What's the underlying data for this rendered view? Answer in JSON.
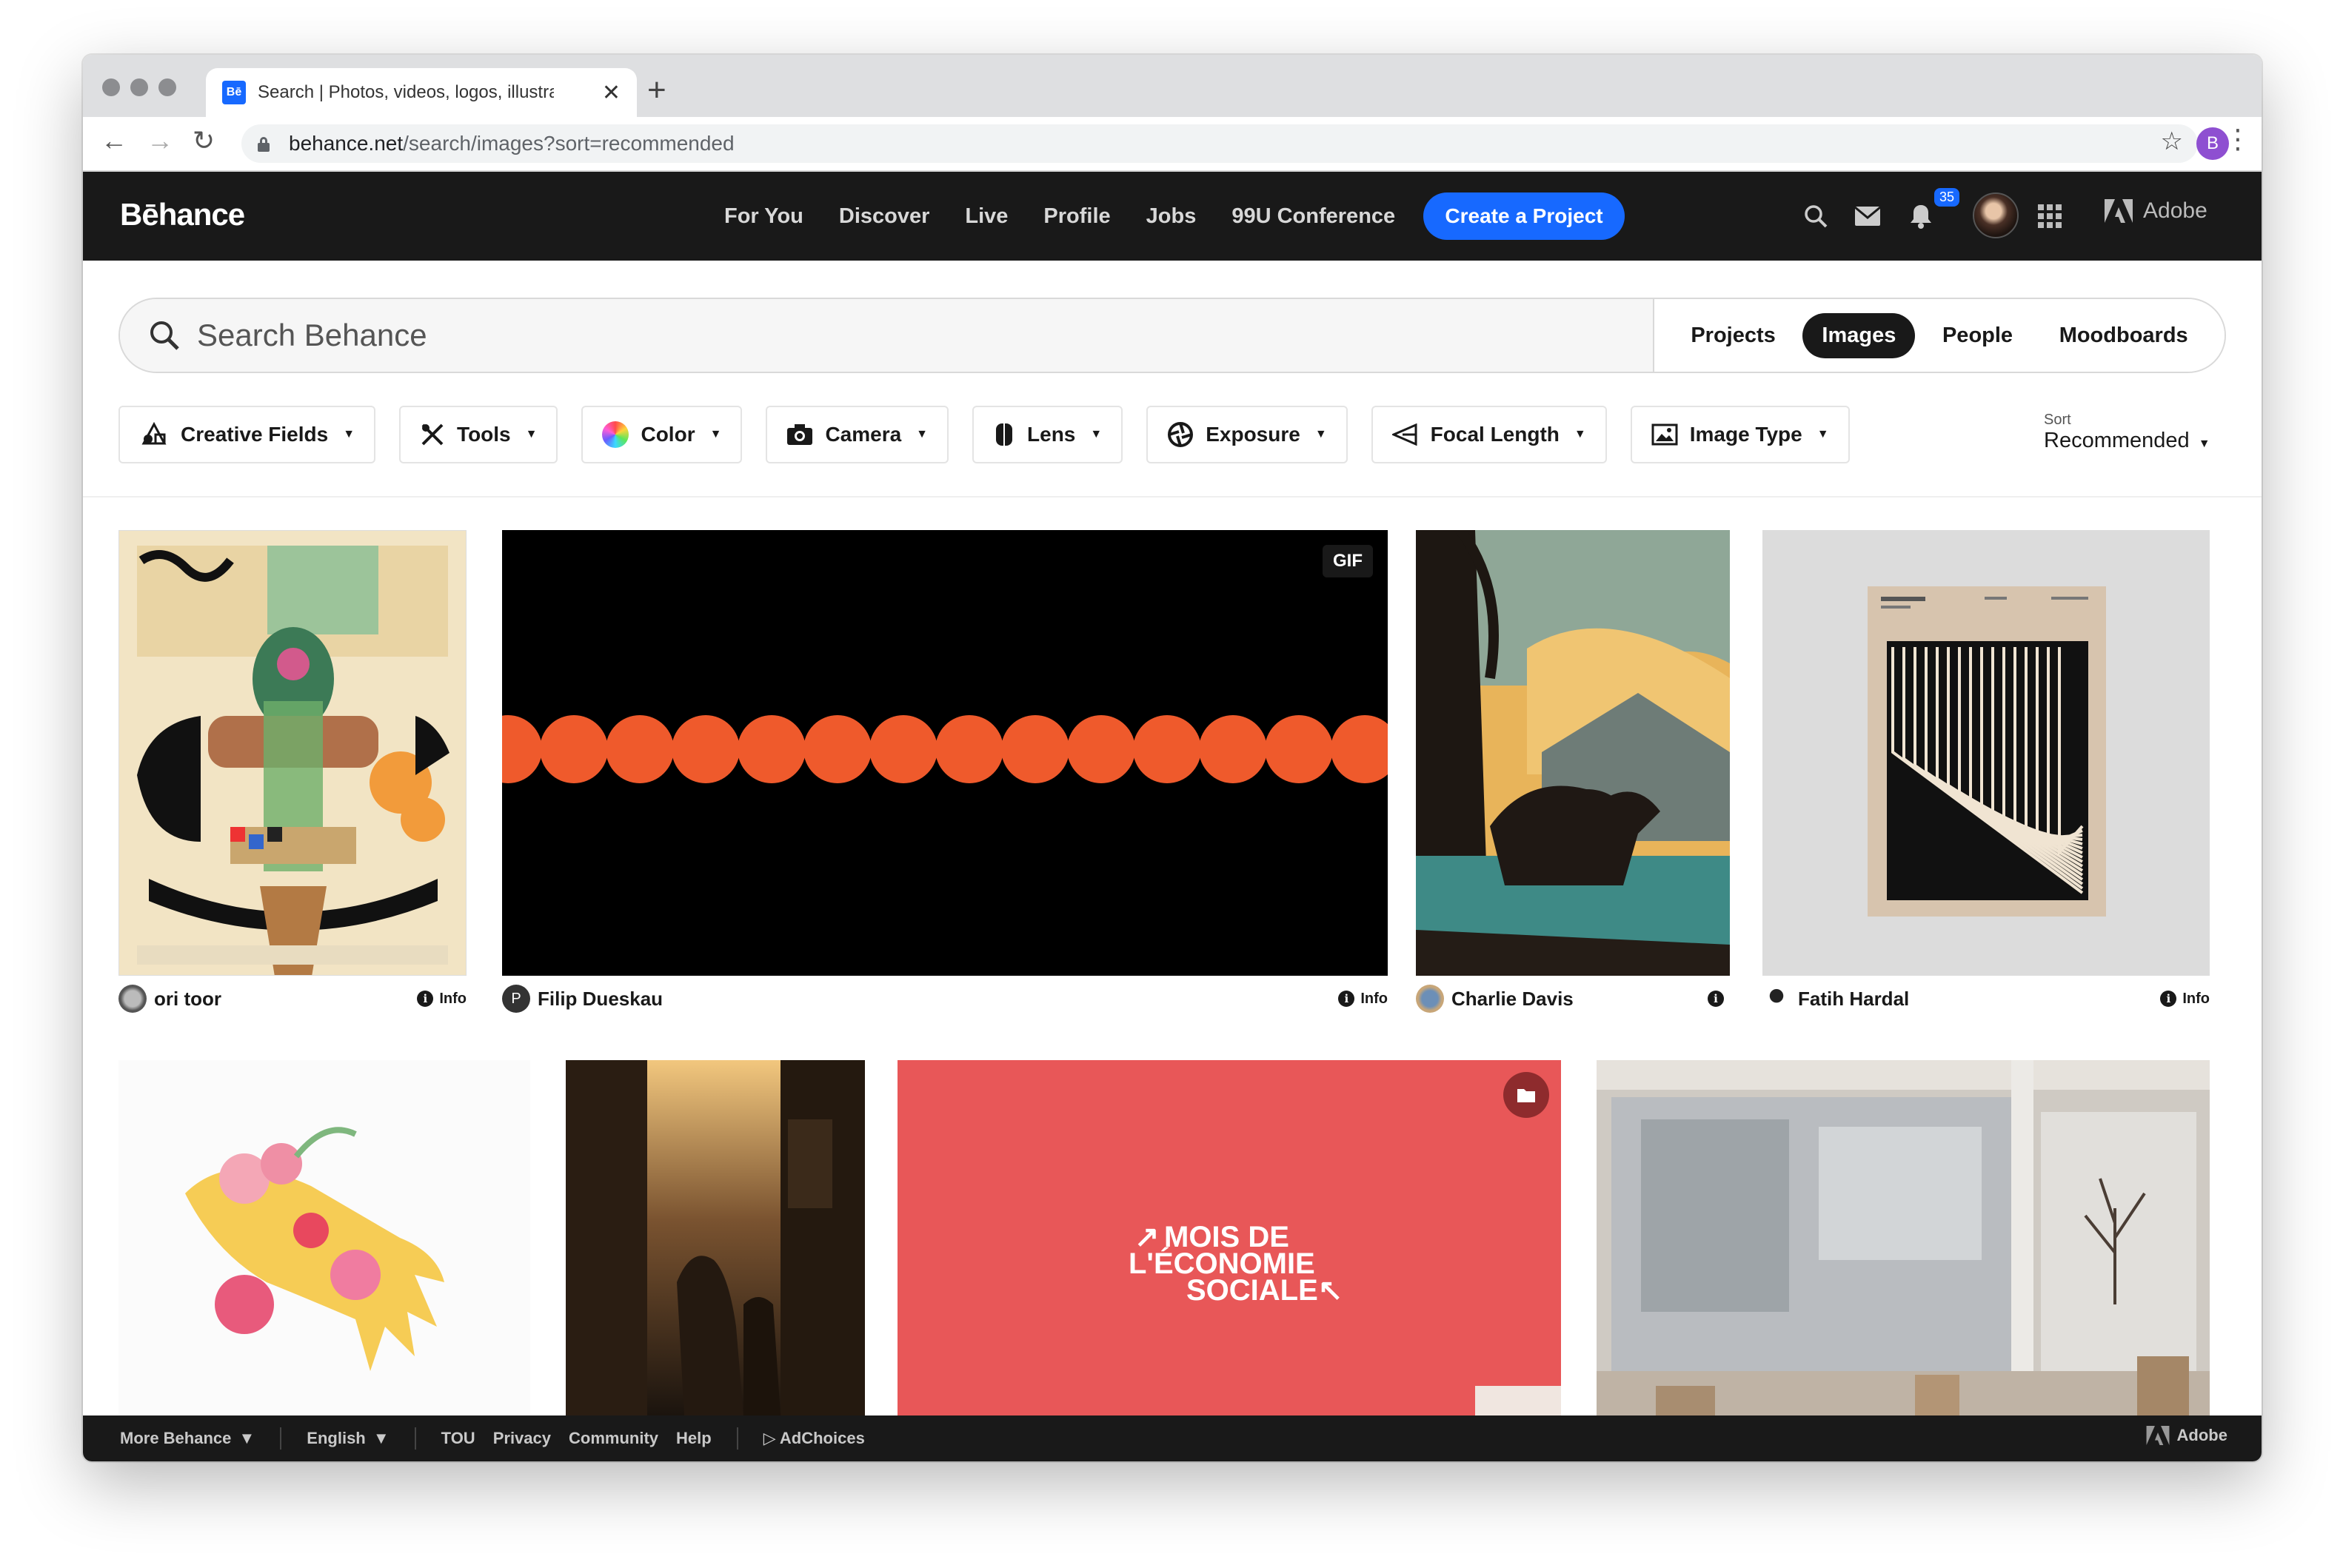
{
  "browser": {
    "tab_title": "Search | Photos, videos, logos, illustrations and branding on Behance",
    "favicon_text": "Bē",
    "url_host": "behance.net",
    "url_path": "/search/images?sort=recommended",
    "profile_initial": "B"
  },
  "header": {
    "logo": "Bēhance",
    "nav": [
      "For You",
      "Discover",
      "Live",
      "Profile",
      "Jobs",
      "99U Conference"
    ],
    "create_button": "Create a Project",
    "notification_count": "35",
    "adobe_label": "Adobe"
  },
  "search": {
    "placeholder": "Search Behance",
    "tabs": [
      {
        "label": "Projects",
        "active": false
      },
      {
        "label": "Images",
        "active": true
      },
      {
        "label": "People",
        "active": false
      },
      {
        "label": "Moodboards",
        "active": false
      }
    ]
  },
  "filters": [
    "Creative Fields",
    "Tools",
    "Color",
    "Camera",
    "Lens",
    "Exposure",
    "Focal Length",
    "Image Type"
  ],
  "sort": {
    "label": "Sort",
    "value": "Recommended"
  },
  "gallery": {
    "row1": [
      {
        "creator": "ori toor",
        "info": "Info"
      },
      {
        "creator": "Filip Dueskau",
        "info": "Info",
        "badge": "GIF"
      },
      {
        "creator": "Charlie Davis",
        "info": ""
      },
      {
        "creator": "Fatih Hardal",
        "info": "Info"
      }
    ],
    "poster_text": "MOIS DE L'ÉCONOMIE SOCIALE"
  },
  "footer": {
    "more": "More Behance",
    "language": "English",
    "links": [
      "TOU",
      "Privacy",
      "Community",
      "Help"
    ],
    "adchoices": "AdChoices",
    "adobe": "Adobe"
  },
  "colors": {
    "brand_blue": "#1769ff",
    "header_bg": "#191919",
    "poster_red": "#e85758",
    "dots_orange": "#ef5a2c"
  }
}
